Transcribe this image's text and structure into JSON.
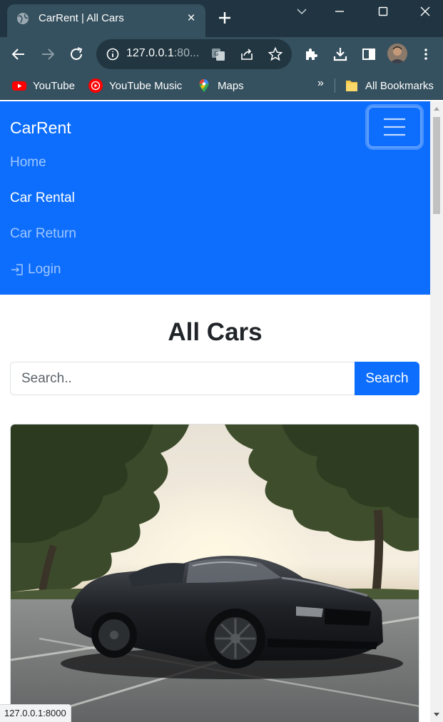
{
  "browser": {
    "tab": {
      "title": "CarRent | All Cars",
      "close_glyph": "×",
      "favicon": "globe-icon"
    },
    "new_tab_icon": "plus-icon",
    "window_controls": [
      "chevron-down-icon",
      "minimize-icon",
      "maximize-icon",
      "close-icon"
    ],
    "address": {
      "host": "127.0.0.1",
      "rest": ":80..."
    },
    "toolbar_icons": [
      "back-icon",
      "forward-icon",
      "reload-icon",
      "info-icon",
      "translate-icon",
      "share-icon",
      "star-icon",
      "extensions-icon",
      "download-icon",
      "side-panel-icon",
      "avatar",
      "more-vert-icon"
    ],
    "bookmarks": [
      {
        "label": "YouTube",
        "icon": "youtube-icon"
      },
      {
        "label": "YouTube Music",
        "icon": "youtube-music-icon"
      },
      {
        "label": "Maps",
        "icon": "maps-icon"
      }
    ],
    "bookmarks_overflow": "»",
    "all_bookmarks": {
      "label": "All Bookmarks",
      "icon": "folder-icon"
    },
    "status_url": "127.0.0.1:8000"
  },
  "page": {
    "navbar": {
      "brand": "CarRent",
      "links": [
        {
          "label": "Home",
          "active": false
        },
        {
          "label": "Car Rental",
          "active": true
        },
        {
          "label": "Car Return",
          "active": false
        },
        {
          "label": "Login",
          "active": false,
          "icon": "login-icon"
        }
      ]
    },
    "heading": "All Cars",
    "search": {
      "placeholder": "Search..",
      "value": "",
      "button_label": "Search"
    },
    "cards": [
      {
        "image": "black sports car parked under trees at sunset"
      }
    ]
  },
  "colors": {
    "navbar": "#0d6efd",
    "primary_button": "#0d6efd",
    "chrome_dark": "#203541",
    "chrome_toolbar": "#35505e"
  }
}
